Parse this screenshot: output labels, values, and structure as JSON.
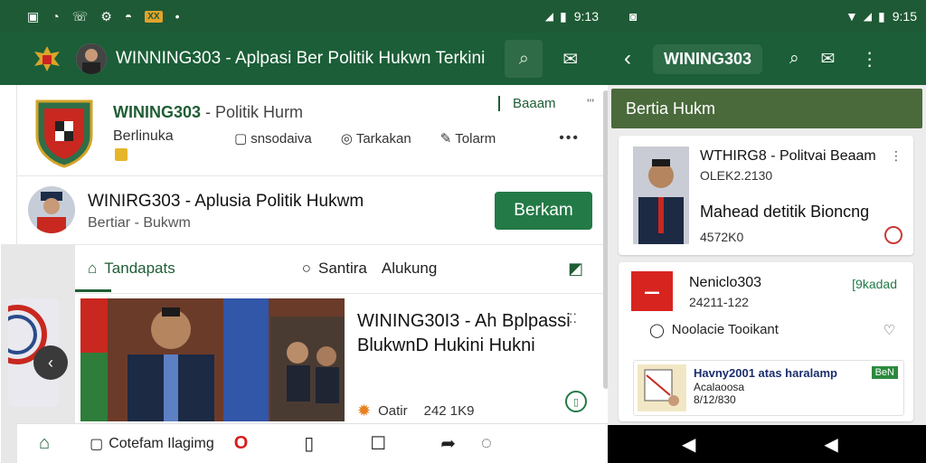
{
  "status_left": {
    "time": "9:13",
    "badge": "XX"
  },
  "status_right": {
    "time": "9:15"
  },
  "app": {
    "title": "WINNING303 - Aplpasi Ber Politik Hukwn Terkini"
  },
  "right_app": {
    "title": "WINING303"
  },
  "profile": {
    "title": "WINING303",
    "title_suffix": "- Politik Hurm",
    "subtitle": "Berlinuka",
    "actions": [
      {
        "label": "snsodaiva"
      },
      {
        "label": "Tarkakan"
      },
      {
        "label": "Tolarm"
      }
    ],
    "right_label": "Baaam",
    "right_dots": "'''"
  },
  "channel": {
    "title": "WINIRG303 - Aplusia Politik Hukwm",
    "subtitle": "Bertiar - Bukwm",
    "follow_label": "Berkam"
  },
  "tabs": [
    {
      "label": "Tandapats"
    },
    {
      "label": "Santira"
    },
    {
      "label": "Alukung"
    }
  ],
  "news": {
    "title": "WINING30I3 - Ah Bplpassi BlukwnD Hukini Hukni",
    "meta_label": "Oatir",
    "meta_time": "242 1K9"
  },
  "bottom_bar": {
    "item_label": "Cotefam Ilagimg"
  },
  "right_panel": {
    "header": "Bertia Hukm",
    "card1": {
      "title": "WTHIRG8 - Politvai Beaam",
      "date": "OLEK2.2130",
      "body": "Mahead detitik Bioncng",
      "count": "4572K0"
    },
    "card2": {
      "name": "Neniclo303",
      "tag": "[9kadad",
      "date": "24211-122",
      "row_label": "Noolacie Tooikant",
      "inner": {
        "title": "Havny2001 atas haralamp",
        "sub": "Acalaoosa",
        "date": "8/12/830",
        "badge": "BeN"
      }
    }
  },
  "colors": {
    "primary_green": "#1b5e37",
    "accent_green": "#237a46",
    "panel_header": "#4a6a3b",
    "status_bar": "#1e5a35"
  }
}
